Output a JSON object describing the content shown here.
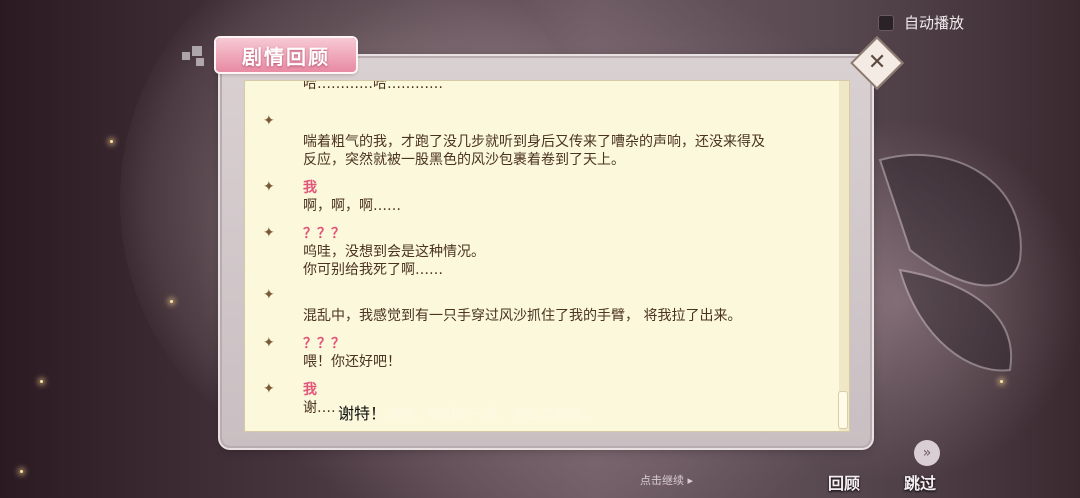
{
  "auto_play": {
    "label": "自动播放"
  },
  "panel": {
    "title": "剧情回顾"
  },
  "log": [
    {
      "speaker": "",
      "text": "哈…………哈…………"
    },
    {
      "speaker": "",
      "text": "喘着粗气的我，才跑了没几步就听到身后又传来了嘈杂的声响，还没来得及\n反应，突然就被一股黑色的风沙包裹着卷到了天上。"
    },
    {
      "speaker": "我",
      "text": "啊，啊，啊……"
    },
    {
      "speaker": "？？？",
      "text": "呜哇，没想到会是这种情况。\n你可别给我死了啊……"
    },
    {
      "speaker": "",
      "text": "混乱中，我感觉到有一只手穿过风沙抓住了我的手臂， 将我拉了出来。"
    },
    {
      "speaker": "？？？",
      "text": "喂！你还好吧！"
    },
    {
      "speaker": "我",
      "text": "谢……"
    }
  ],
  "overlay_text": "谢特！",
  "ghost_text": "说完，我眼前一黑，失去了知觉。",
  "footer": {
    "continue": "点击继续 ▸",
    "review": "回顾",
    "skip": "跳过"
  },
  "icons": {
    "close": "close-icon",
    "skip": "fast-forward-icon",
    "entry": "sparkle-icon"
  },
  "colors": {
    "speaker": "#e2557a",
    "text": "#4b3320",
    "paper": "#fbf8dc",
    "tab": "#e88aa3"
  }
}
